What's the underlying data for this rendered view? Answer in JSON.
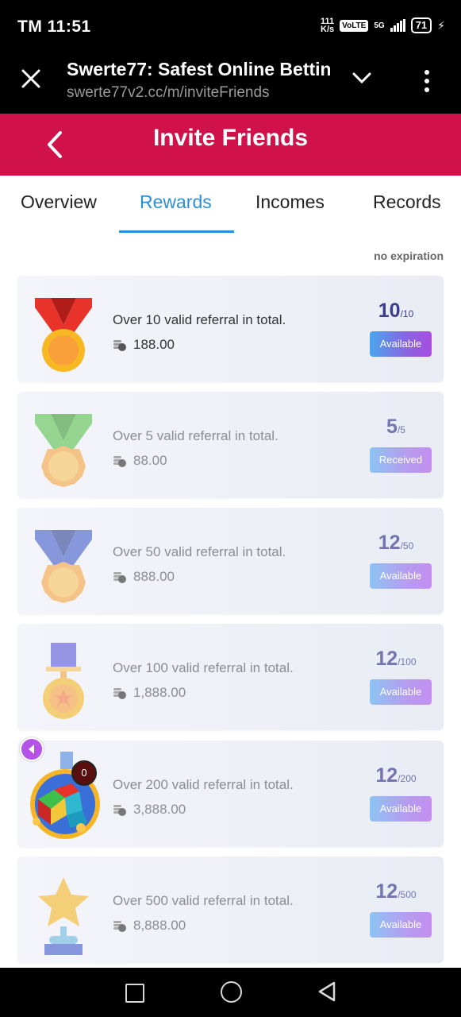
{
  "status_bar": {
    "time": "TM 11:51",
    "speed_top": "111",
    "speed_unit": "K/s",
    "volte": "VoLTE",
    "network": "5G",
    "battery": "71"
  },
  "browser": {
    "title": "Swerte77: Safest Online Bettin",
    "url": "swerte77v2.cc/m/inviteFriends"
  },
  "header": {
    "title": "Invite Friends"
  },
  "tabs": [
    {
      "label": "Overview"
    },
    {
      "label": "Rewards"
    },
    {
      "label": "Incomes"
    },
    {
      "label": "Records"
    }
  ],
  "active_tab": "Rewards",
  "note": "no expiration",
  "rewards": [
    {
      "description": "Over 10 valid referral in total.",
      "amount": "188.00",
      "current": "10",
      "target": "/10",
      "status": "Available",
      "medal": "red-ribbon-medal-icon"
    },
    {
      "description": "Over 5 valid referral in total.",
      "amount": "88.00",
      "current": "5",
      "target": "/5",
      "status": "Received",
      "medal": "green-ribbon-medal-icon"
    },
    {
      "description": "Over 50 valid referral in total.",
      "amount": "888.00",
      "current": "12",
      "target": "/50",
      "status": "Available",
      "medal": "blue-ribbon-medal-icon"
    },
    {
      "description": "Over 100 valid referral in total.",
      "amount": "1,888.00",
      "current": "12",
      "target": "/100",
      "status": "Available",
      "medal": "purple-ribbon-medal-icon"
    },
    {
      "description": "Over 200 valid referral in total.",
      "amount": "3,888.00",
      "current": "12",
      "target": "/200",
      "status": "Available",
      "medal": "game-cube-icon"
    },
    {
      "description": "Over 500 valid referral in total.",
      "amount": "8,888.00",
      "current": "12",
      "target": "/500",
      "status": "Available",
      "medal": "star-trophy-icon"
    }
  ],
  "floating_badge": "0",
  "colors": {
    "header": "#d0114a",
    "tab_active": "#2b8fd6",
    "progress_text": "#3d3d8f"
  }
}
